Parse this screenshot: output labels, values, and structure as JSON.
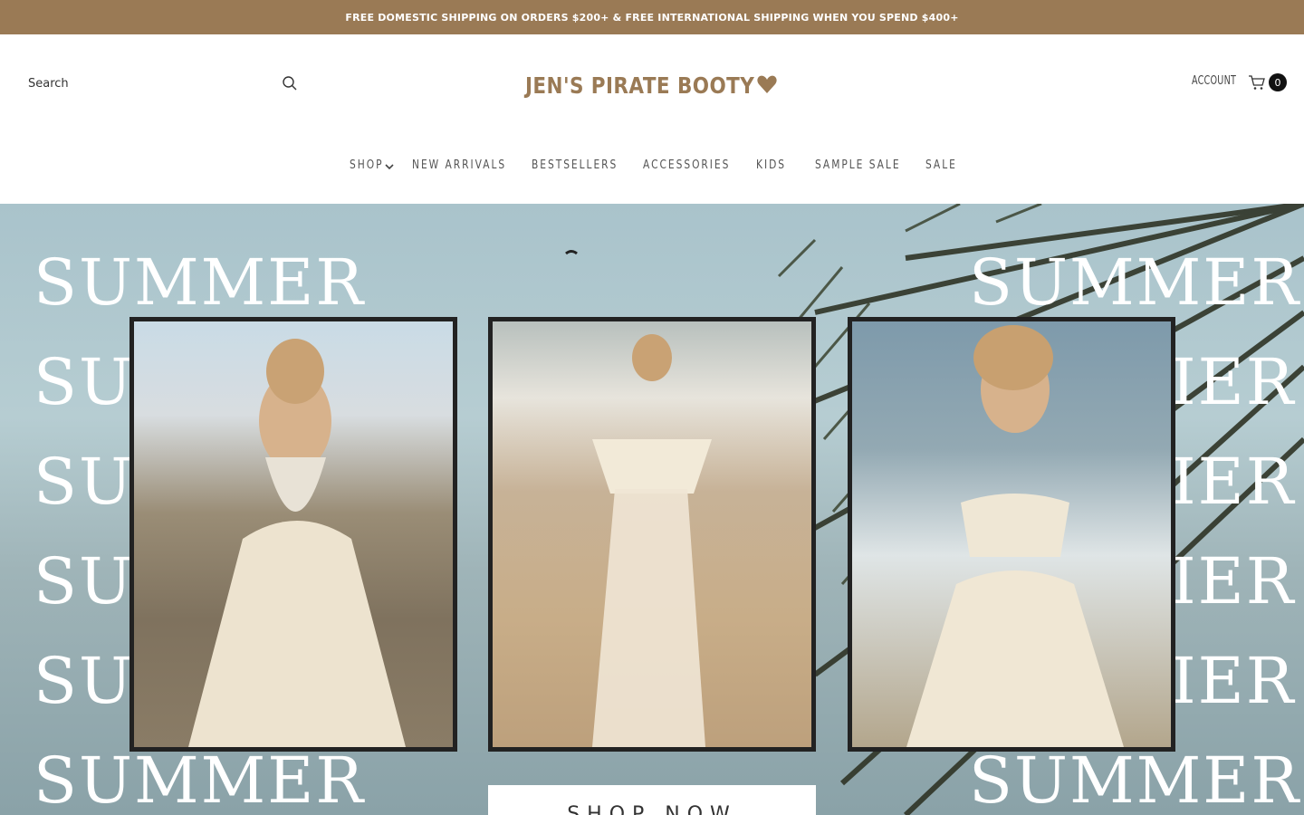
{
  "announcement": "FREE DOMESTIC SHIPPING ON ORDERS $200+ & FREE INTERNATIONAL SHIPPING WHEN YOU SPEND $400+",
  "search": {
    "placeholder": "Search"
  },
  "logo": "JEN'S PIRATE BOOTY",
  "account": "ACCOUNT",
  "cart": {
    "count": "0"
  },
  "nav": {
    "shop": "SHOP",
    "new_arrivals": "NEW ARRIVALS",
    "bestsellers": "BESTSELLERS",
    "accessories": "ACCESSORIES",
    "kids": "KIDS",
    "sample_sale": "SAMPLE SALE",
    "sale": "SALE"
  },
  "hero": {
    "summer": "SUMMER",
    "summer_left_partial": "SU",
    "summer_right_partial": "MER",
    "summer_right_partial_2": "IER",
    "button": "SHOP NOW"
  },
  "colors": {
    "brand": "#9a7a55",
    "dark": "#111111"
  }
}
